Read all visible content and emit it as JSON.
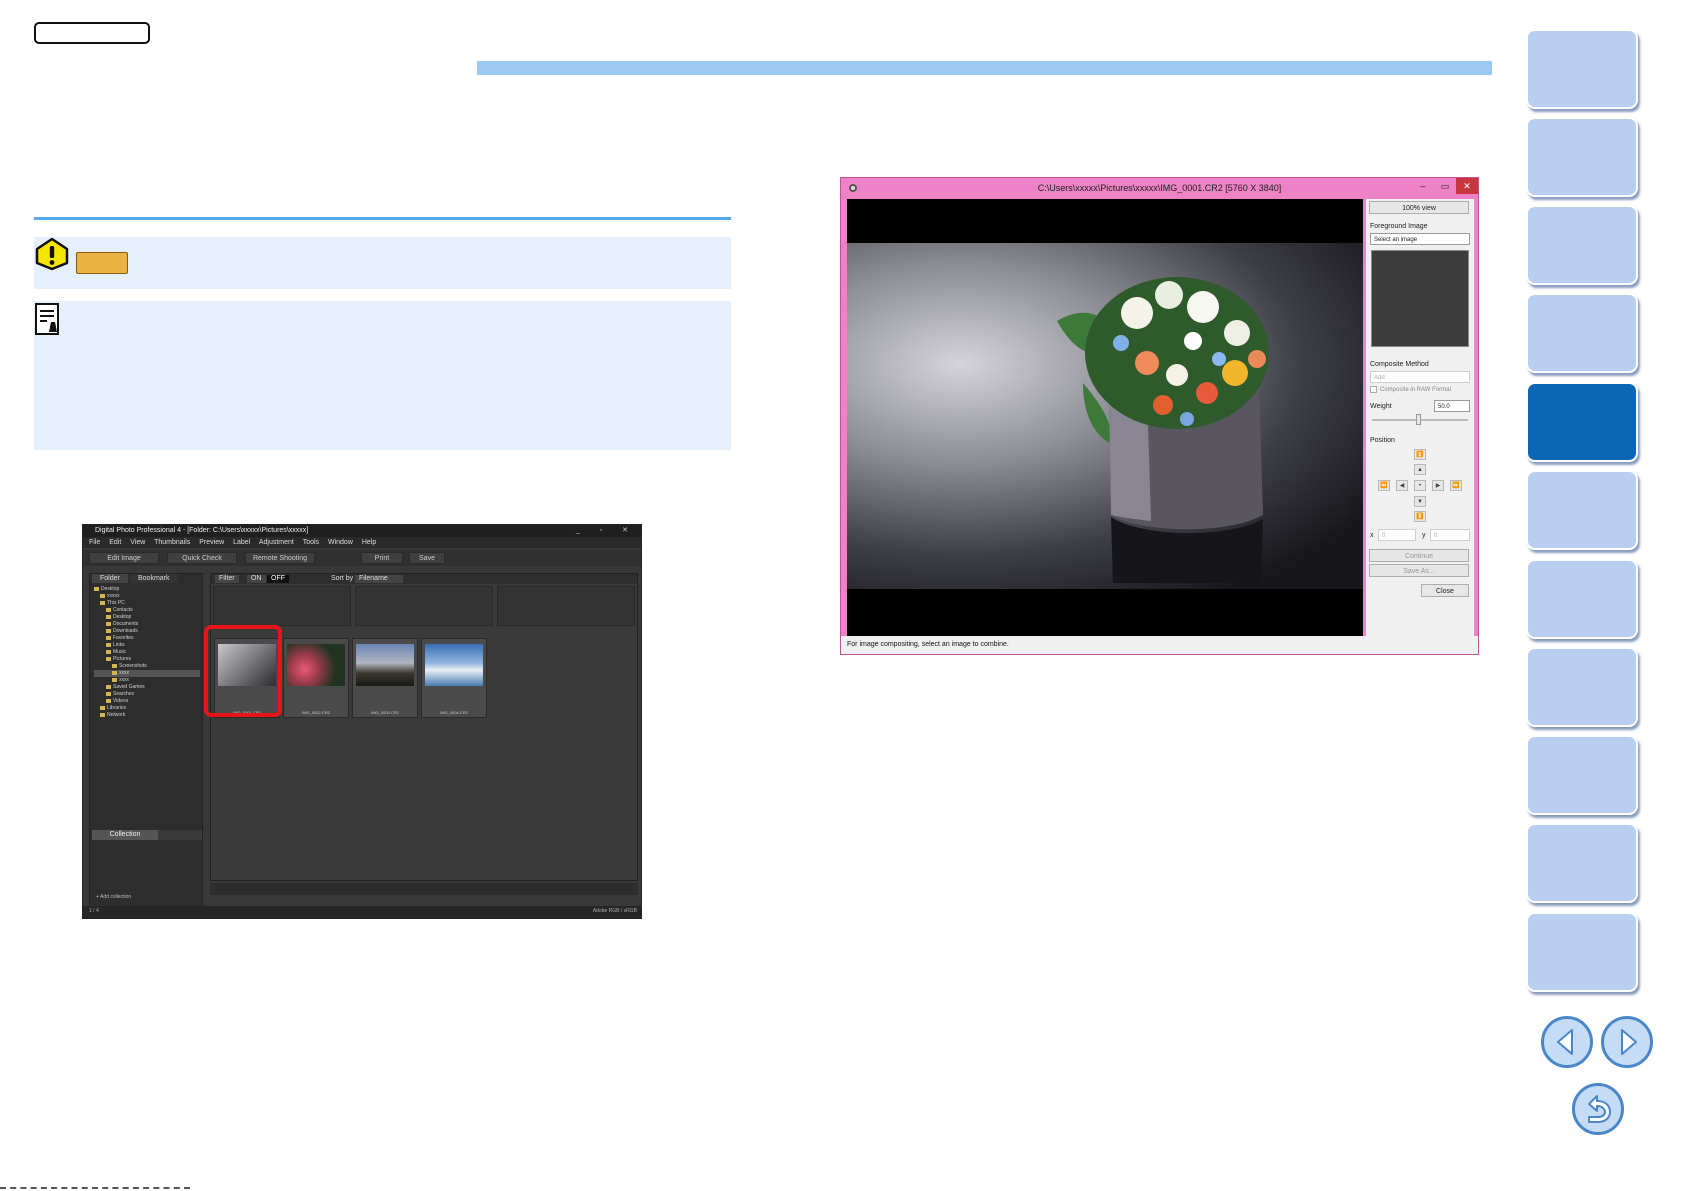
{
  "dpp": {
    "title": "Digital Photo Professional 4 - [Folder: C:\\Users\\xxxxx\\Pictures\\xxxxx]",
    "menu": [
      "File",
      "Edit",
      "View",
      "Thumbnails",
      "Preview",
      "Label",
      "Adjustment",
      "Tools",
      "Window",
      "Help"
    ],
    "toolbar": {
      "edit_image": "Edit Image",
      "quick_check": "Quick Check",
      "remote_shooting": "Remote Shooting",
      "print": "Print",
      "save": "Save"
    },
    "panel_tabs": {
      "folder": "Folder",
      "bookmark": "Bookmark"
    },
    "tree": [
      "Desktop",
      "xxxxx",
      "This PC",
      "Contacts",
      "Desktop",
      "Documents",
      "Downloads",
      "Favorites",
      "Links",
      "Music",
      "Pictures",
      "Screenshots",
      "xxxx",
      "xxxx",
      "Saved Games",
      "Searches",
      "Videos",
      "Libraries",
      "Network"
    ],
    "filter": {
      "label": "Filter",
      "on": "ON",
      "off": "OFF",
      "sort_by": "Sort by",
      "sort_value": "Filename"
    },
    "thumbnails": [
      "IMG_0001.CR2",
      "IMG_0002.CR2",
      "IMG_0003.CR2",
      "IMG_0004.CR2"
    ],
    "collection_tab": "Collection",
    "add_collection": "Add collection",
    "status_count": "1 / 4",
    "color_profile": "Adobe RGB / sRGB"
  },
  "composite": {
    "title": "C:\\Users\\xxxxx\\Pictures\\xxxxx\\IMG_0001.CR2 [5760 X 3840]",
    "view_100": "100% view",
    "foreground_label": "Foreground Image",
    "foreground_select": "Select an image",
    "method_label": "Composite Method",
    "method_value": "Add",
    "raw_checkbox": "Composite in RAW Format",
    "weight_label": "Weight",
    "weight_value": "50.0",
    "position_label": "Position",
    "x_label": "x",
    "x_value": "0",
    "y_label": "y",
    "y_value": "0",
    "continue": "Continue",
    "save_as": "Save As...",
    "close": "Close",
    "status": "For image compositing, select an image to combine."
  }
}
